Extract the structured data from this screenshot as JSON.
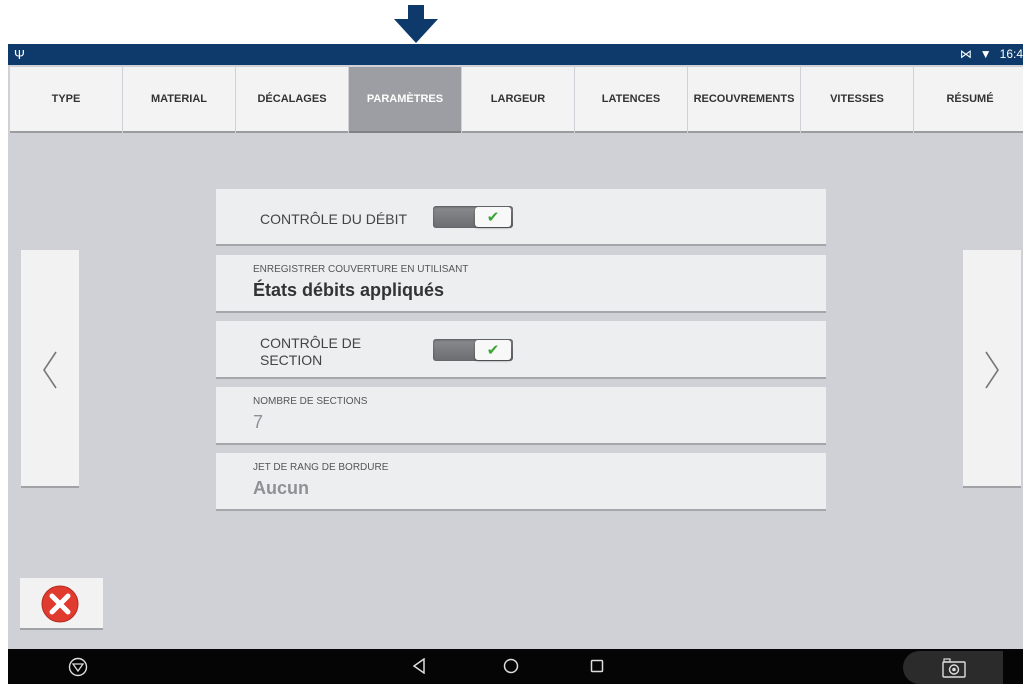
{
  "status": {
    "time": "16:4"
  },
  "tabs": [
    {
      "label": "TYPE",
      "active": false
    },
    {
      "label": "MATERIAL",
      "active": false
    },
    {
      "label": "DÉCALAGES",
      "active": false
    },
    {
      "label": "PARAMÈTRES",
      "active": true
    },
    {
      "label": "LARGEUR",
      "active": false
    },
    {
      "label": "LATENCES",
      "active": false
    },
    {
      "label": "RECOUVREMENTS",
      "active": false
    },
    {
      "label": "VITESSES",
      "active": false
    },
    {
      "label": "RÉSUMÉ",
      "active": false
    }
  ],
  "settings": {
    "rate_control": {
      "label": "CONTRÔLE DU DÉBIT",
      "enabled": true
    },
    "coverage": {
      "caption": "ENREGISTRER COUVERTURE EN UTILISANT",
      "value": "États débits appliqués"
    },
    "section_control": {
      "label_line1": "CONTRÔLE DE",
      "label_line2": "SECTION",
      "enabled": true
    },
    "sections": {
      "caption": "NOMBRE DE SECTIONS",
      "value": "7"
    },
    "boundary": {
      "caption": "JET DE RANG DE BORDURE",
      "value": "Aucun"
    }
  },
  "colors": {
    "accent": "#0e3a6b",
    "active_tab": "#9c9ea3",
    "check": "#3aa535",
    "cancel": "#e03b2e"
  }
}
